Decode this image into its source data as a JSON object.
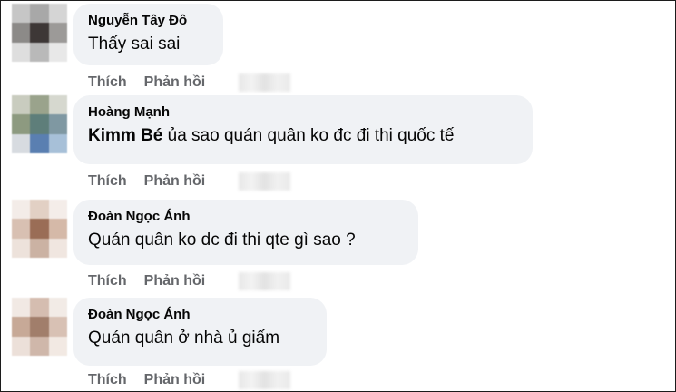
{
  "comments": [
    {
      "author": "Nguyễn Tây Đô",
      "mention": "",
      "text": "Thấy sai sai",
      "like_label": "Thích",
      "reply_label": "Phản hồi",
      "avatar_colors": [
        "#c6c6c6",
        "#a8a8a8",
        "#d5d5d5",
        "#8c8a88",
        "#3d3736",
        "#9c9a98",
        "#dedede",
        "#b9b9b9",
        "#e8e8e8"
      ]
    },
    {
      "author": "Hoàng Mạnh",
      "mention": "Kimm Bé",
      "text": " ủa sao quán quân ko đc đi thi quốc tế",
      "like_label": "Thích",
      "reply_label": "Phản hồi",
      "avatar_colors": [
        "#c9ccbf",
        "#9aa38c",
        "#d6d8cf",
        "#8d9a80",
        "#5e7e7a",
        "#7f98a2",
        "#d7dbe0",
        "#5a7fb1",
        "#a7c0d8"
      ]
    },
    {
      "author": "Đoàn Ngọc Ánh",
      "mention": "",
      "text": "Quán quân ko dc đi thi qte gì sao ?",
      "like_label": "Thích",
      "reply_label": "Phản hồi",
      "avatar_colors": [
        "#f3ece8",
        "#e2d0c4",
        "#f4ede9",
        "#d8c0b2",
        "#9a6d56",
        "#d5b9a8",
        "#ede2db",
        "#cbb2a3",
        "#f0e6e0"
      ]
    },
    {
      "author": "Đoàn Ngọc Ánh",
      "mention": "",
      "text": "Quán quân ở nhà ủ giấm",
      "like_label": "Thích",
      "reply_label": "Phản hồi",
      "avatar_colors": [
        "#f1e9e4",
        "#d5bdb0",
        "#f2ebe6",
        "#c7a997",
        "#a17e6b",
        "#d8c1b4",
        "#ece0d9",
        "#cfb7aa",
        "#f2e9e3"
      ]
    }
  ]
}
